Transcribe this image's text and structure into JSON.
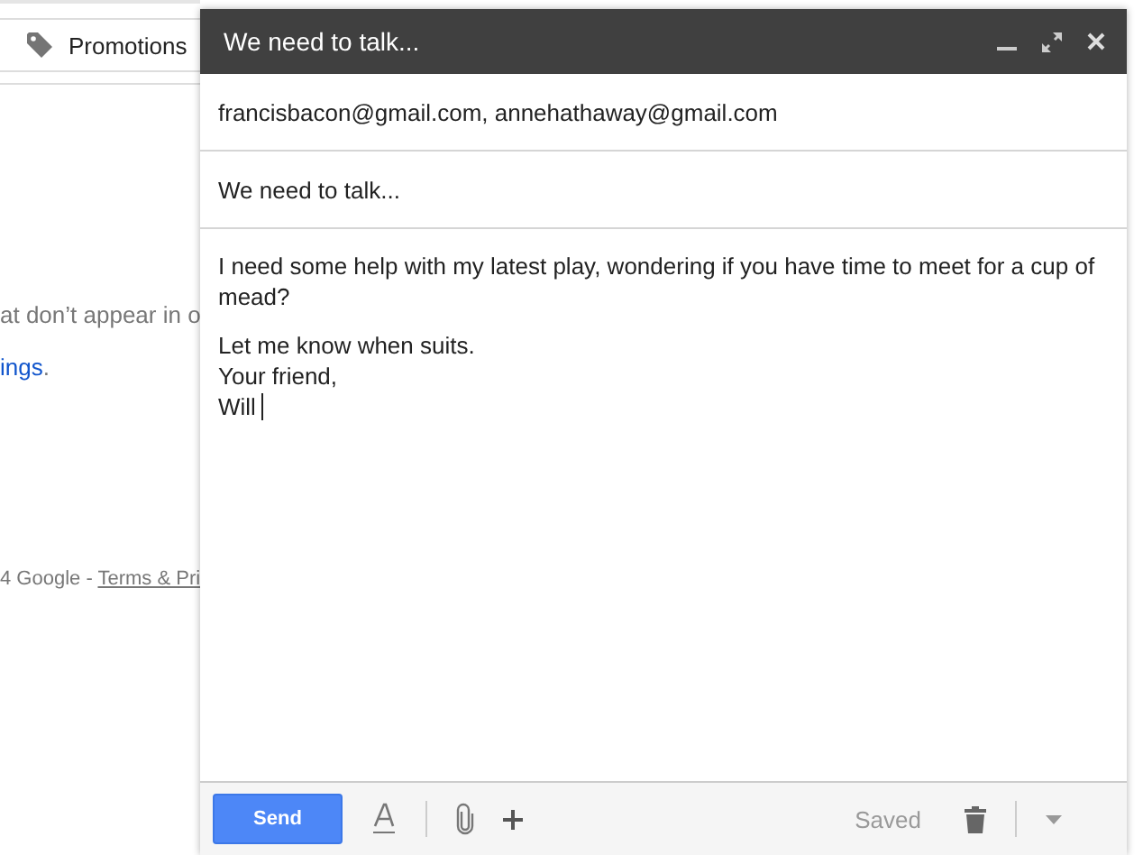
{
  "background": {
    "tab": {
      "label": "Promotions"
    },
    "notice_text": "at don’t appear in o",
    "settings_link": "ings",
    "settings_link_after": ".",
    "footer_text": "4 Google - ",
    "footer_link": "Terms & Pri"
  },
  "compose": {
    "title": "We need to talk...",
    "recipients": "francisbacon@gmail.com, annehathaway@gmail.com",
    "subject": "We need to talk...",
    "body": [
      "I need some help with my latest play, wondering if you have time to meet for a cup of mead?",
      "Let me know when suits.\nYour friend,\nWill"
    ],
    "send": "Send",
    "status": "Saved"
  }
}
